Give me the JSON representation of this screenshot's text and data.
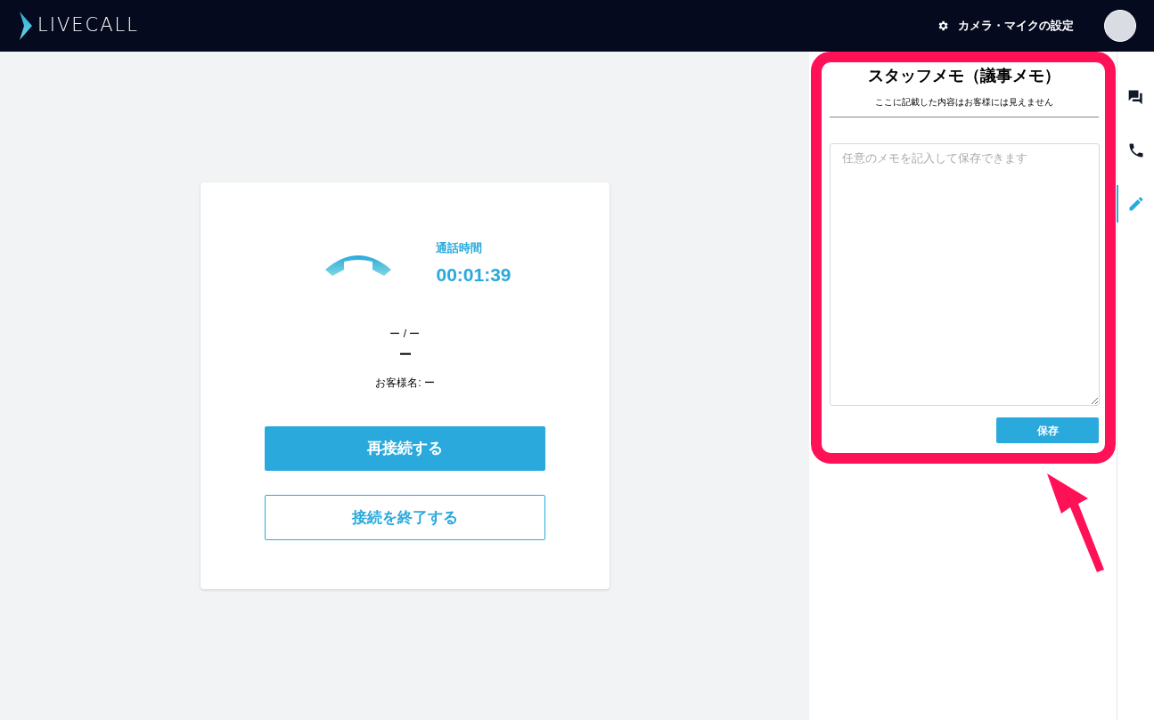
{
  "header": {
    "logo": "LIVECALL",
    "settings_link": "カメラ・マイクの設定"
  },
  "call_card": {
    "duration_label": "通話時間",
    "duration": "00:01:39",
    "line_1": "ー / ー",
    "line_2": "ー",
    "customer": "お客様名: ー",
    "buttons": [
      {
        "kind": "primary",
        "label": "再接続する"
      },
      {
        "kind": "outline",
        "label": "接続を終了する"
      }
    ]
  },
  "memo": {
    "title": "スタッフメモ（議事メモ）",
    "note": "ここに記載した内容はお客様には見えません",
    "placeholder": "任意のメモを記入して保存できます",
    "save": "保存"
  },
  "side_rail": [
    {
      "kind": "chat",
      "selected": false
    },
    {
      "kind": "phone",
      "selected": false
    },
    {
      "kind": "pencil",
      "selected": true
    }
  ]
}
